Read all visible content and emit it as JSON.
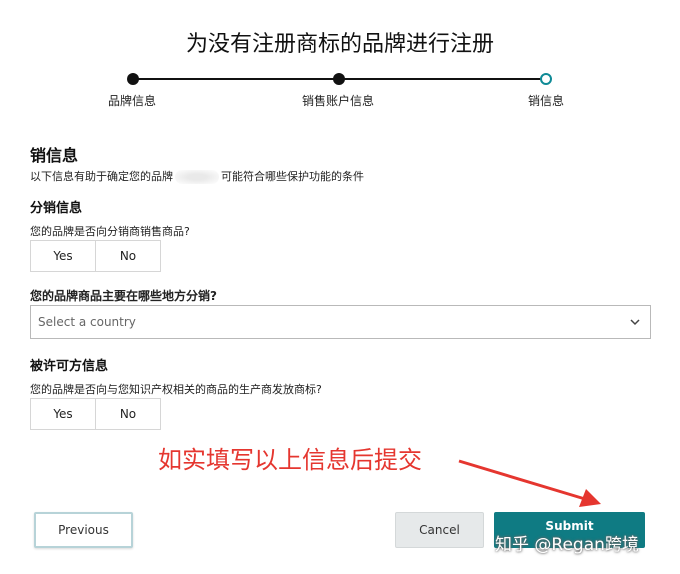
{
  "page": {
    "title": "为没有注册商标的品牌进行注册"
  },
  "stepper": {
    "steps": [
      {
        "label": "品牌信息"
      },
      {
        "label": "销售账户信息"
      },
      {
        "label": "销信息"
      }
    ],
    "current_step": 3
  },
  "section": {
    "title": "销信息",
    "desc_prefix": "以下信息有助于确定您的品牌",
    "desc_suffix": "可能符合哪些保护功能的条件"
  },
  "distribution": {
    "title": "分销信息",
    "question": "您的品牌是否向分销商销售商品?",
    "yes_label": "Yes",
    "no_label": "No"
  },
  "where_distribute": {
    "question": "您的品牌商品主要在哪些地方分销?",
    "placeholder": "Select a country"
  },
  "licensee": {
    "title": "被许可方信息",
    "question": "您的品牌是否向与您知识产权相关的商品的生产商发放商标?",
    "yes_label": "Yes",
    "no_label": "No"
  },
  "annotation": {
    "text": "如实填写以上信息后提交"
  },
  "buttons": {
    "previous": "Previous",
    "cancel": "Cancel",
    "submit": "Submit"
  },
  "watermark": {
    "text": "知乎 @Regan跨境"
  },
  "colors": {
    "accent": "#0f7b83",
    "annotation": "#e5362f"
  }
}
